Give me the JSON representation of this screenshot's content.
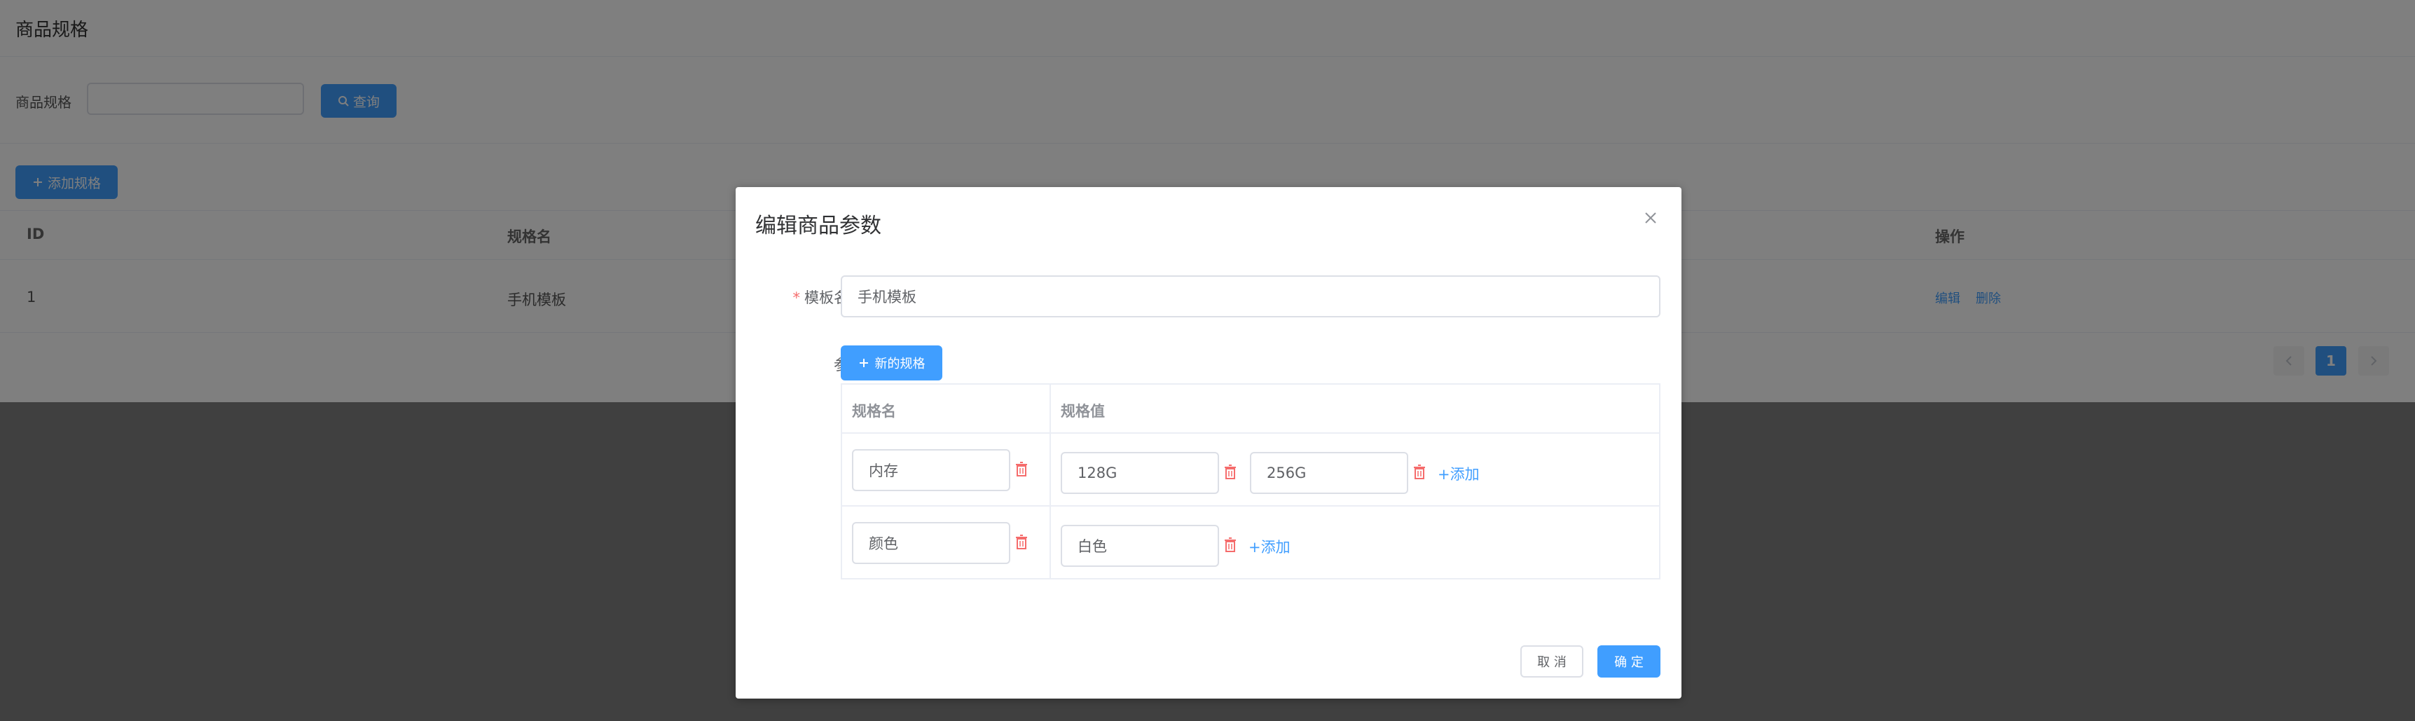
{
  "page": {
    "title": "商品规格",
    "filter_label": "商品规格",
    "search_value": "",
    "search_button": "查询",
    "add_button": "添加规格",
    "table": {
      "headers": [
        "ID",
        "规格名",
        "操作"
      ],
      "rows": [
        {
          "id": "1",
          "name": "手机模板",
          "actions": [
            "编辑",
            "删除"
          ]
        }
      ]
    },
    "pagination": {
      "current": "1"
    }
  },
  "dialog": {
    "title": "编辑商品参数",
    "template_label": "模板名称",
    "template_value": "手机模板",
    "params_label": "参数",
    "new_spec_button": "新的规格",
    "spec_headers": [
      "规格名",
      "规格值"
    ],
    "specs": [
      {
        "name": "内存",
        "values": [
          "128G",
          "256G"
        ],
        "add_label": "+添加"
      },
      {
        "name": "颜色",
        "values": [
          "白色"
        ],
        "add_label": "+添加"
      }
    ],
    "cancel_button": "取 消",
    "confirm_button": "确 定"
  },
  "colors": {
    "primary": "#409eff",
    "danger": "#f56c6c",
    "overlay": "rgba(0,0,0,0.5)"
  },
  "icons": [
    "search-icon",
    "plus-icon",
    "close-icon",
    "trash-icon",
    "chevron-left-icon",
    "chevron-right-icon"
  ]
}
